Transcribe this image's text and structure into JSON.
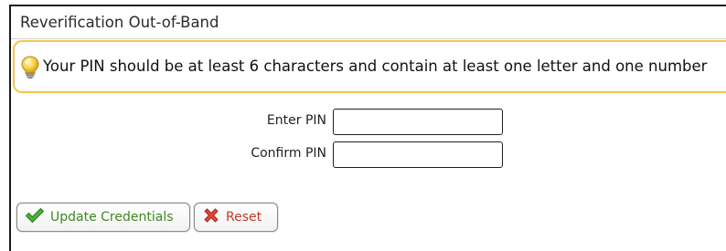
{
  "panel": {
    "title": "Reverification Out-of-Band"
  },
  "hint": {
    "icon": "lightbulb-icon",
    "text": "Your PIN should be at least 6 characters and contain at least one letter and one number"
  },
  "form": {
    "enter_pin_label": "Enter PIN",
    "enter_pin_value": "",
    "confirm_pin_label": "Confirm PIN",
    "confirm_pin_value": ""
  },
  "actions": {
    "update_label": "Update Credentials",
    "update_icon": "checkmark-icon",
    "reset_label": "Reset",
    "reset_icon": "x-icon"
  },
  "colors": {
    "hint_border": "#f3c64a",
    "update_text": "#3d8a1e",
    "reset_text": "#c0392b"
  }
}
